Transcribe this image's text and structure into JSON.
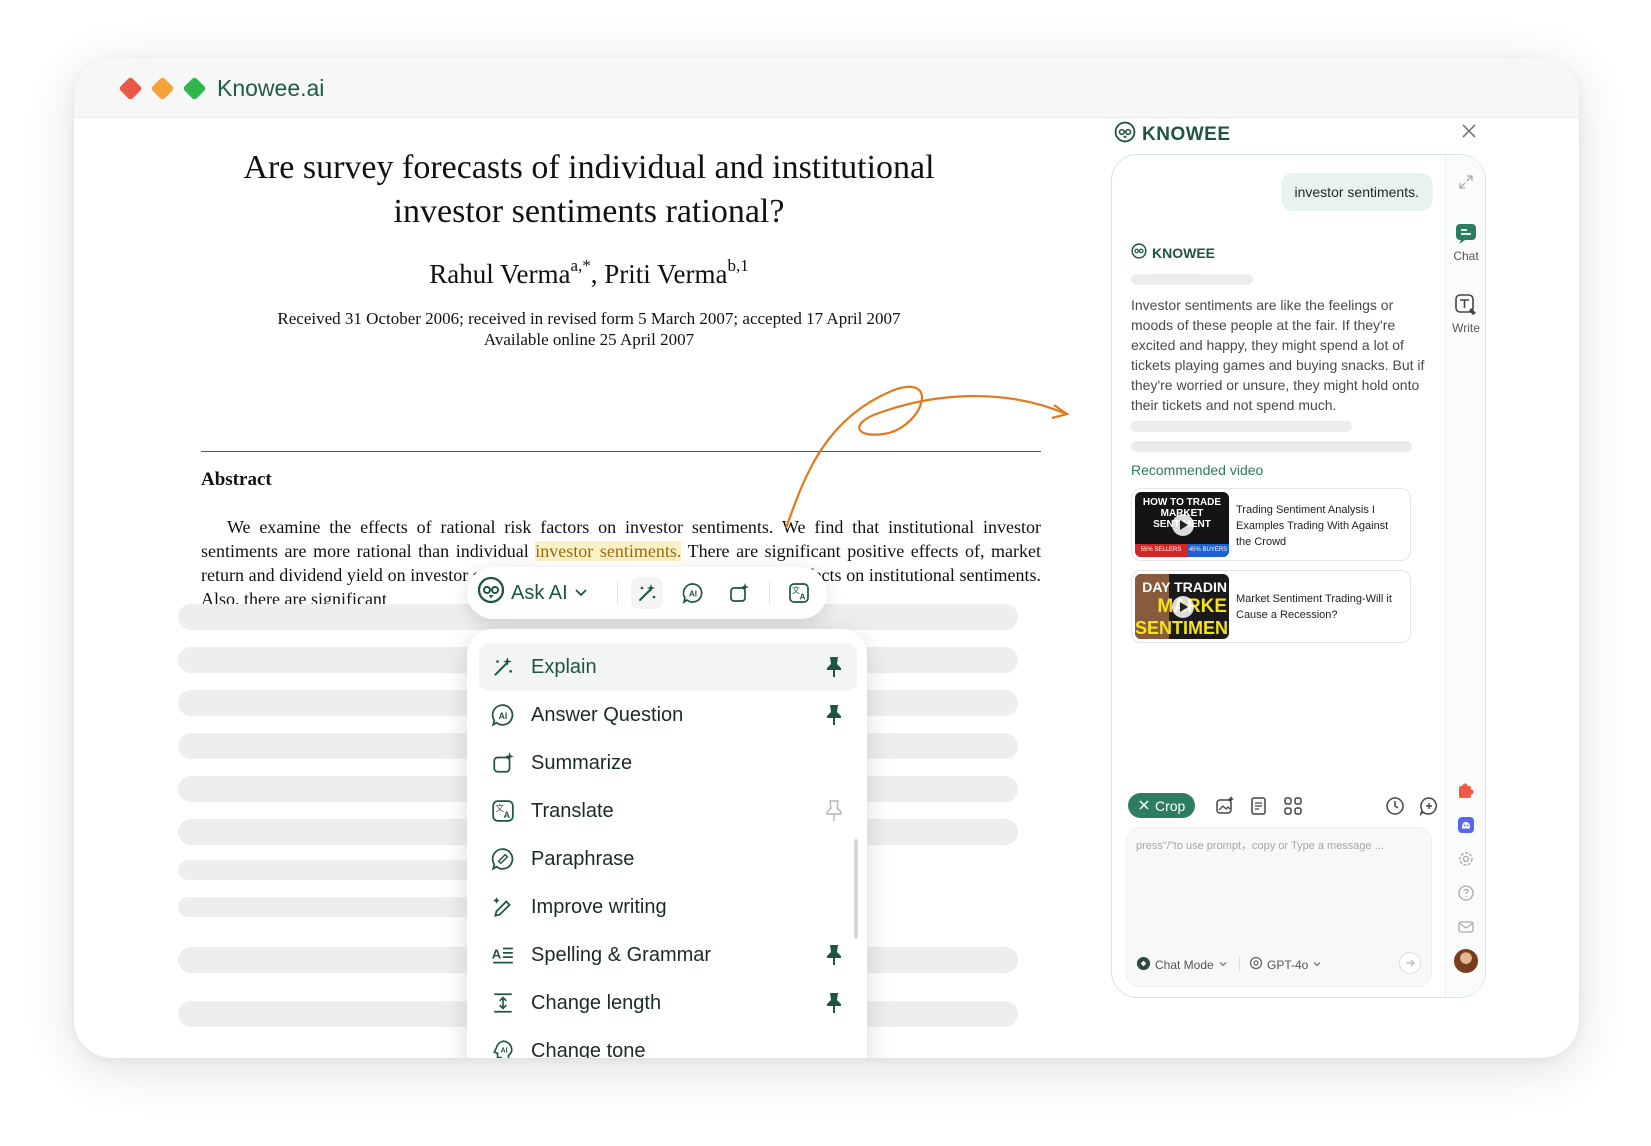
{
  "window": {
    "title": "Knowee.ai"
  },
  "paper": {
    "title": "Are survey forecasts of individual and institutional investor sentiments rational?",
    "author1": "Rahul Verma",
    "author1_sup": "a,*",
    "author_sep": ",",
    "author2": "Priti Verma",
    "author2_sup": "b,1",
    "dates_line1": "Received 31 October 2006; received in revised form 5 March 2007; accepted 17 April 2007",
    "dates_line2": "Available online 25 April 2007",
    "abstract_heading": "Abstract",
    "abstract_before": "We examine the effects of rational risk factors on investor sentiments. We find that institutional investor sentiments are more rational than individual ",
    "abstract_highlight": "investor sentiments.",
    "abstract_after": " There are significant positive effects of, market return and dividend yield on investor sentiments. These risk factors have stronger effects on institutional sentiments. Also, there are significant"
  },
  "toolbar": {
    "ask_ai_label": "Ask AI",
    "icons": [
      "magic-wand-icon",
      "ai-bubble-icon",
      "summarize-icon",
      "translate-icon"
    ]
  },
  "menu": {
    "items": [
      {
        "label": "Explain",
        "icon": "magic-wand-icon",
        "pinned": true
      },
      {
        "label": "Answer Question",
        "icon": "ai-bubble-icon",
        "pinned": true
      },
      {
        "label": "Summarize",
        "icon": "summarize-icon",
        "pinned": false
      },
      {
        "label": "Translate",
        "icon": "translate-icon",
        "pinned": "outline"
      },
      {
        "label": "Paraphrase",
        "icon": "paraphrase-icon",
        "pinned": false
      },
      {
        "label": "Improve writing",
        "icon": "pen-sparkle-icon",
        "pinned": false
      },
      {
        "label": "Spelling & Grammar",
        "icon": "spelling-icon",
        "pinned": true
      },
      {
        "label": "Change length",
        "icon": "length-icon",
        "pinned": true
      },
      {
        "label": "Change tone",
        "icon": "tone-icon",
        "pinned": false
      }
    ]
  },
  "panel": {
    "brand": "KNOWEE",
    "user_message": "investor sentiments.",
    "answer_brand": "KNOWEE",
    "answer_text": "Investor sentiments are like the feelings or moods of these people at the fair. If they're excited and happy, they might spend a lot of tickets playing games and buying snacks. But if they're worried or unsure, they might hold onto their tickets and not spend much.",
    "recommended_label": "Recommended video",
    "videos": [
      {
        "title": "Trading Sentiment Analysis I Examples Trading With Against the Crowd",
        "thumb_line1": "HOW TO TRADE",
        "thumb_line2": "MARKET",
        "thumb_line3": "SENTIMENT",
        "thumb_left": "55% SELLERS",
        "thumb_right": "45% BUYERS"
      },
      {
        "title": "Market Sentiment Trading-Will it Cause a Recession?",
        "thumb_line1": "DAY TRADIN",
        "thumb_line2": "MARKE",
        "thumb_line3": "SENTIMEN"
      }
    ],
    "crop_label": "Crop",
    "input_placeholder": "press\"/\"to use prompt，copy or Type a message ...",
    "mode_label": "Chat Mode",
    "model_label": "GPT-4o",
    "rail": {
      "chat_label": "Chat",
      "write_label": "Write"
    }
  },
  "colors": {
    "brand": "#1e5443",
    "accent": "#2d7d60",
    "highlight_bg": "#fbf1c7",
    "arrow": "#e07a1c"
  }
}
